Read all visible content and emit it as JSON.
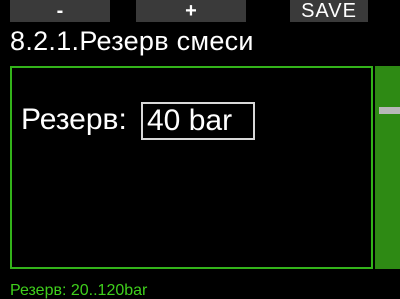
{
  "softkeys": {
    "minus_label": "-",
    "plus_label": "+",
    "save_label": "SAVE"
  },
  "title": "8.2.1.Резерв смеси",
  "field": {
    "label": "Резерв:",
    "value": "40 bar"
  },
  "hint": "Резерв: 20..120bar",
  "colors": {
    "accent": "#33b31a",
    "scrollbar": "#2e8a14",
    "scroll_thumb": "#b8b8b8",
    "softkey_bg": "#3a3a3a",
    "hint_text": "#3fcf1c",
    "background": "#000000"
  }
}
